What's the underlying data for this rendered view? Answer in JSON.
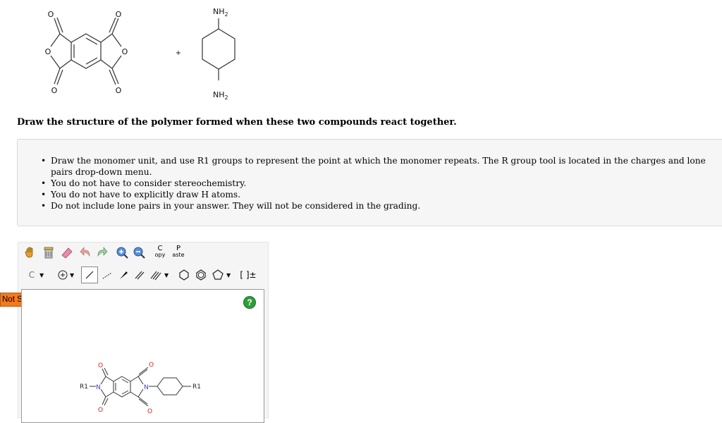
{
  "reaction": {
    "o_label": "O",
    "nh2_top": "NH",
    "nh2_bottom": "NH",
    "sub2": "2",
    "plus": "+"
  },
  "question": "Draw the structure of the polymer formed when these two compounds react together.",
  "instructions": [
    "Draw the monomer unit, and use R1 groups to represent the point at which the monomer repeats. The R group tool is located in the charges and lone pairs drop-down menu.",
    "You do not have to consider stereochemistry.",
    "You do not have to explicitly draw H atoms.",
    "Do not include lone pairs in your answer. They will not be considered in the grading."
  ],
  "toolbar": {
    "copy_top": "C",
    "copy_bottom": "opy",
    "paste_top": "P",
    "paste_bottom": "aste",
    "element": "C",
    "dropdown_arrow": "▼",
    "bracket": "[ ]±"
  },
  "status": "Not Submitted",
  "help": "?",
  "answer": {
    "r1_left": "R1",
    "r1_right": "R1",
    "n_label": "N",
    "o_label": "O"
  },
  "colors": {
    "status_bg": "#f47a1f",
    "help_bg": "#2e9e3a",
    "nitrogen": "#3344cc",
    "oxygen": "#cc2222"
  }
}
